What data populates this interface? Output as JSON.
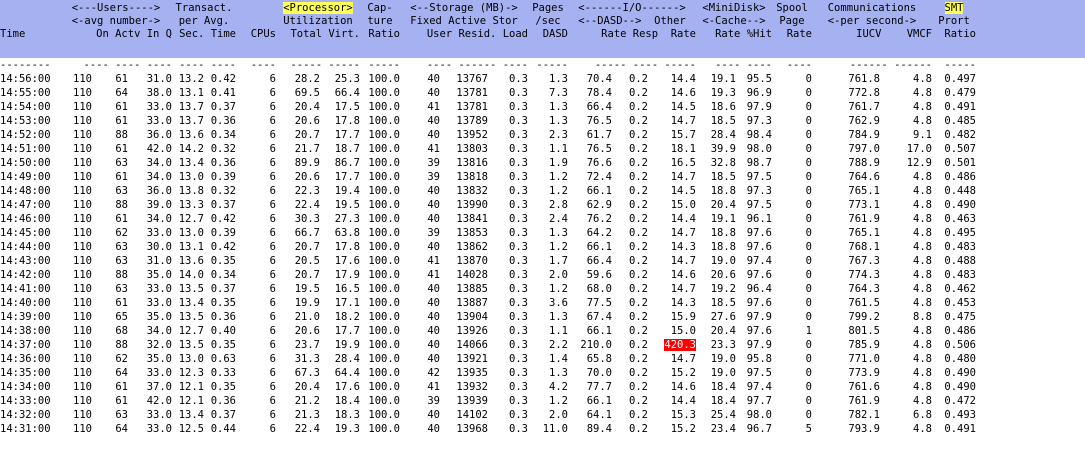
{
  "colors": {
    "header_bg": "#a6b1f2",
    "highlight": "#ffff55",
    "alert": "#ff0000",
    "page_bg": "#ffffff"
  },
  "header_lines": [
    [
      "",
      "<---Users---->",
      "Transact.",
      "",
      "<Processor>",
      "Cap-",
      "<--Storage (MB)->",
      "Pages",
      "<------I/O------>",
      "<MiniDisk>",
      "Spool",
      "Communications",
      "SMT"
    ],
    [
      "",
      "<-avg number->",
      "per Avg.",
      "",
      "Utilization",
      "ture",
      "Fixed Active Stor",
      "/sec",
      "<--DASD-->  Other",
      "<-Cache-->",
      "Page",
      "<-per second->",
      "Prort"
    ],
    [
      "Time",
      "On Actv In Q",
      "Sec. Time",
      "CPUs",
      "Total Virt.",
      "Ratio",
      "User Resid. Load",
      "DASD",
      "Rate Resp  Rate",
      "Rate %Hit",
      "Rate",
      "IUCV    VMCF",
      "Ratio"
    ],
    [
      "--------",
      "---- ---- ----",
      "---- ----",
      "----",
      "----- -----",
      "-----",
      "---- ------ ----",
      "-----",
      "----- ---- -----",
      "---- ----",
      "----",
      "------ ------",
      "-----"
    ]
  ],
  "rows": [
    [
      "14:56:00",
      "110",
      "61",
      "31.0",
      "13.2",
      "0.42",
      "6",
      "28.2",
      "25.3",
      "100.0",
      "40",
      "13767",
      "0.3",
      "1.3",
      "70.4",
      "0.2",
      "14.4",
      "19.1",
      "95.5",
      "0",
      "761.8",
      "4.8",
      "0.497"
    ],
    [
      "14:55:00",
      "110",
      "64",
      "38.0",
      "13.1",
      "0.41",
      "6",
      "69.5",
      "66.4",
      "100.0",
      "40",
      "13781",
      "0.3",
      "7.3",
      "78.4",
      "0.2",
      "14.6",
      "19.3",
      "96.9",
      "0",
      "772.8",
      "4.8",
      "0.479"
    ],
    [
      "14:54:00",
      "110",
      "61",
      "33.0",
      "13.7",
      "0.37",
      "6",
      "20.4",
      "17.5",
      "100.0",
      "41",
      "13781",
      "0.3",
      "1.3",
      "66.4",
      "0.2",
      "14.5",
      "18.6",
      "97.9",
      "0",
      "761.7",
      "4.8",
      "0.491"
    ],
    [
      "14:53:00",
      "110",
      "61",
      "33.0",
      "13.7",
      "0.36",
      "6",
      "20.6",
      "17.8",
      "100.0",
      "40",
      "13789",
      "0.3",
      "1.3",
      "76.5",
      "0.2",
      "14.7",
      "18.5",
      "97.3",
      "0",
      "762.9",
      "4.8",
      "0.485"
    ],
    [
      "14:52:00",
      "110",
      "88",
      "36.0",
      "13.6",
      "0.34",
      "6",
      "20.7",
      "17.7",
      "100.0",
      "40",
      "13952",
      "0.3",
      "2.3",
      "61.7",
      "0.2",
      "15.7",
      "28.4",
      "98.4",
      "0",
      "784.9",
      "9.1",
      "0.482"
    ],
    [
      "14:51:00",
      "110",
      "61",
      "42.0",
      "14.2",
      "0.32",
      "6",
      "21.7",
      "18.7",
      "100.0",
      "41",
      "13803",
      "0.3",
      "1.1",
      "76.5",
      "0.2",
      "18.1",
      "39.9",
      "98.0",
      "0",
      "797.0",
      "17.0",
      "0.507"
    ],
    [
      "14:50:00",
      "110",
      "63",
      "34.0",
      "13.4",
      "0.36",
      "6",
      "89.9",
      "86.7",
      "100.0",
      "39",
      "13816",
      "0.3",
      "1.9",
      "76.6",
      "0.2",
      "16.5",
      "32.8",
      "98.7",
      "0",
      "788.9",
      "12.9",
      "0.501"
    ],
    [
      "14:49:00",
      "110",
      "61",
      "34.0",
      "13.0",
      "0.39",
      "6",
      "20.6",
      "17.7",
      "100.0",
      "39",
      "13818",
      "0.3",
      "1.2",
      "72.4",
      "0.2",
      "14.7",
      "18.5",
      "97.5",
      "0",
      "764.6",
      "4.8",
      "0.486"
    ],
    [
      "14:48:00",
      "110",
      "63",
      "36.0",
      "13.8",
      "0.32",
      "6",
      "22.3",
      "19.4",
      "100.0",
      "40",
      "13832",
      "0.3",
      "1.2",
      "66.1",
      "0.2",
      "14.5",
      "18.8",
      "97.3",
      "0",
      "765.1",
      "4.8",
      "0.448"
    ],
    [
      "14:47:00",
      "110",
      "88",
      "39.0",
      "13.3",
      "0.37",
      "6",
      "22.4",
      "19.5",
      "100.0",
      "40",
      "13990",
      "0.3",
      "2.8",
      "62.9",
      "0.2",
      "15.0",
      "20.4",
      "97.5",
      "0",
      "773.1",
      "4.8",
      "0.490"
    ],
    [
      "14:46:00",
      "110",
      "61",
      "34.0",
      "12.7",
      "0.42",
      "6",
      "30.3",
      "27.3",
      "100.0",
      "40",
      "13841",
      "0.3",
      "2.4",
      "76.2",
      "0.2",
      "14.4",
      "19.1",
      "96.1",
      "0",
      "761.9",
      "4.8",
      "0.463"
    ],
    [
      "14:45:00",
      "110",
      "62",
      "33.0",
      "13.0",
      "0.39",
      "6",
      "66.7",
      "63.8",
      "100.0",
      "39",
      "13853",
      "0.3",
      "1.3",
      "64.2",
      "0.2",
      "14.7",
      "18.8",
      "97.6",
      "0",
      "765.1",
      "4.8",
      "0.495"
    ],
    [
      "14:44:00",
      "110",
      "63",
      "30.0",
      "13.1",
      "0.42",
      "6",
      "20.7",
      "17.8",
      "100.0",
      "40",
      "13862",
      "0.3",
      "1.2",
      "66.1",
      "0.2",
      "14.3",
      "18.8",
      "97.6",
      "0",
      "768.1",
      "4.8",
      "0.483"
    ],
    [
      "14:43:00",
      "110",
      "63",
      "31.0",
      "13.6",
      "0.35",
      "6",
      "20.5",
      "17.6",
      "100.0",
      "41",
      "13870",
      "0.3",
      "1.7",
      "66.4",
      "0.2",
      "14.7",
      "19.0",
      "97.4",
      "0",
      "767.3",
      "4.8",
      "0.488"
    ],
    [
      "14:42:00",
      "110",
      "88",
      "35.0",
      "14.0",
      "0.34",
      "6",
      "20.7",
      "17.9",
      "100.0",
      "41",
      "14028",
      "0.3",
      "2.0",
      "59.6",
      "0.2",
      "14.6",
      "20.6",
      "97.6",
      "0",
      "774.3",
      "4.8",
      "0.483"
    ],
    [
      "14:41:00",
      "110",
      "63",
      "33.0",
      "13.5",
      "0.37",
      "6",
      "19.5",
      "16.5",
      "100.0",
      "40",
      "13885",
      "0.3",
      "1.2",
      "68.0",
      "0.2",
      "14.7",
      "19.2",
      "96.4",
      "0",
      "764.3",
      "4.8",
      "0.462"
    ],
    [
      "14:40:00",
      "110",
      "61",
      "33.0",
      "13.4",
      "0.35",
      "6",
      "19.9",
      "17.1",
      "100.0",
      "40",
      "13887",
      "0.3",
      "3.6",
      "77.5",
      "0.2",
      "14.3",
      "18.5",
      "97.6",
      "0",
      "761.5",
      "4.8",
      "0.453"
    ],
    [
      "14:39:00",
      "110",
      "65",
      "35.0",
      "13.5",
      "0.36",
      "6",
      "21.0",
      "18.2",
      "100.0",
      "40",
      "13904",
      "0.3",
      "1.3",
      "67.4",
      "0.2",
      "15.9",
      "27.6",
      "97.9",
      "0",
      "799.2",
      "8.8",
      "0.475"
    ],
    [
      "14:38:00",
      "110",
      "68",
      "34.0",
      "12.7",
      "0.40",
      "6",
      "20.6",
      "17.7",
      "100.0",
      "40",
      "13926",
      "0.3",
      "1.1",
      "66.1",
      "0.2",
      "15.0",
      "20.4",
      "97.6",
      "1",
      "801.5",
      "4.8",
      "0.486"
    ],
    [
      "14:37:00",
      "110",
      "88",
      "32.0",
      "13.5",
      "0.35",
      "6",
      "23.7",
      "19.9",
      "100.0",
      "40",
      "14066",
      "0.3",
      "2.2",
      "210.0",
      "0.2",
      "420.3",
      "23.3",
      "97.9",
      "0",
      "785.9",
      "4.8",
      "0.506"
    ],
    [
      "14:36:00",
      "110",
      "62",
      "35.0",
      "13.0",
      "0.63",
      "6",
      "31.3",
      "28.4",
      "100.0",
      "40",
      "13921",
      "0.3",
      "1.4",
      "65.8",
      "0.2",
      "14.7",
      "19.0",
      "95.8",
      "0",
      "771.0",
      "4.8",
      "0.480"
    ],
    [
      "14:35:00",
      "110",
      "64",
      "33.0",
      "12.3",
      "0.33",
      "6",
      "67.3",
      "64.4",
      "100.0",
      "42",
      "13935",
      "0.3",
      "1.3",
      "70.0",
      "0.2",
      "15.2",
      "19.0",
      "97.5",
      "0",
      "773.9",
      "4.8",
      "0.490"
    ],
    [
      "14:34:00",
      "110",
      "61",
      "37.0",
      "12.1",
      "0.35",
      "6",
      "20.4",
      "17.6",
      "100.0",
      "41",
      "13932",
      "0.3",
      "4.2",
      "77.7",
      "0.2",
      "14.6",
      "18.4",
      "97.4",
      "0",
      "761.6",
      "4.8",
      "0.490"
    ],
    [
      "14:33:00",
      "110",
      "61",
      "42.0",
      "12.1",
      "0.36",
      "6",
      "21.2",
      "18.4",
      "100.0",
      "39",
      "13939",
      "0.3",
      "1.2",
      "66.1",
      "0.2",
      "14.4",
      "18.4",
      "97.7",
      "0",
      "761.9",
      "4.8",
      "0.472"
    ],
    [
      "14:32:00",
      "110",
      "63",
      "33.0",
      "13.4",
      "0.37",
      "6",
      "21.3",
      "18.3",
      "100.0",
      "40",
      "14102",
      "0.3",
      "2.0",
      "64.1",
      "0.2",
      "15.3",
      "25.4",
      "98.0",
      "0",
      "782.1",
      "6.8",
      "0.493"
    ],
    [
      "14:31:00",
      "110",
      "64",
      "33.0",
      "12.5",
      "0.44",
      "6",
      "22.4",
      "19.3",
      "100.0",
      "40",
      "13968",
      "0.3",
      "11.0",
      "89.4",
      "0.2",
      "15.2",
      "23.4",
      "96.7",
      "5",
      "793.9",
      "4.8",
      "0.491"
    ]
  ]
}
